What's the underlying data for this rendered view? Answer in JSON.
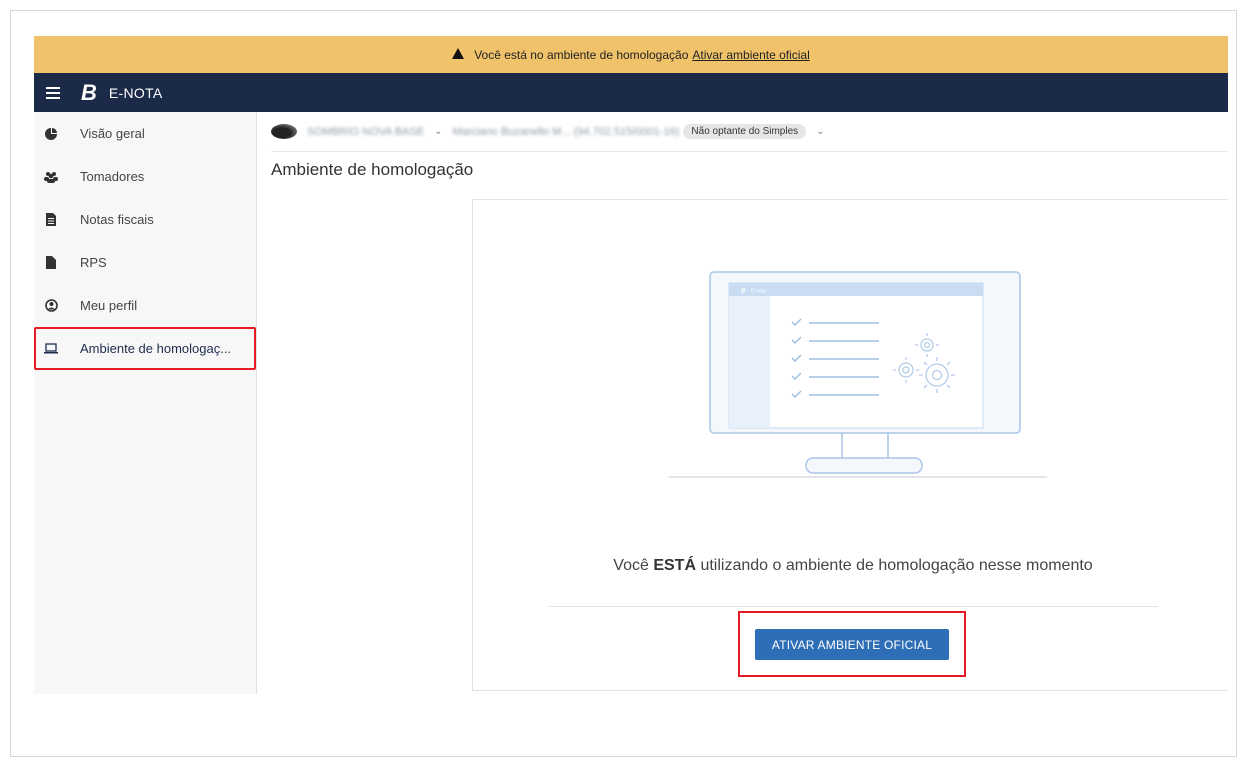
{
  "banner": {
    "text": "Você está no ambiente de homologação",
    "link": "Ativar ambiente oficial"
  },
  "topbar": {
    "logo_letter": "B",
    "brand": "E-NOTA"
  },
  "sidebar": {
    "items": [
      {
        "label": "Visão geral",
        "icon": "pie-chart-icon"
      },
      {
        "label": "Tomadores",
        "icon": "users-icon"
      },
      {
        "label": "Notas fiscais",
        "icon": "document-icon"
      },
      {
        "label": "RPS",
        "icon": "file-icon"
      },
      {
        "label": "Meu perfil",
        "icon": "user-circle-icon"
      },
      {
        "label": "Ambiente de homologaç...",
        "icon": "laptop-icon",
        "active": true
      }
    ]
  },
  "company_bar": {
    "company": "SOMBRIO NOVA BASE",
    "person": "Marciano Buzanello M... (94.702.515/0001-16)",
    "tax_regime": "Não optante do Simples"
  },
  "page": {
    "title": "Ambiente de homologação",
    "message_pre": "Você ",
    "message_bold": "ESTÁ",
    "message_post": " utilizando o ambiente de homologação nesse momento",
    "button": "ATIVAR AMBIENTE OFICIAL",
    "illustration_brand": "E-nota"
  },
  "colors": {
    "banner": "#f0c36a",
    "topbar": "#1b2a48",
    "button": "#2e6eb6",
    "highlight": "#e31b23"
  }
}
